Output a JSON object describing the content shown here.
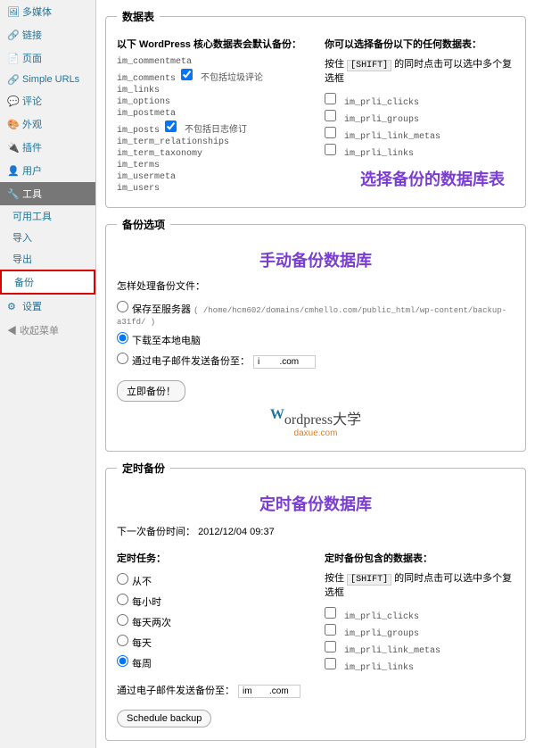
{
  "sidebar": {
    "items": [
      {
        "label": "多媒体"
      },
      {
        "label": "链接"
      },
      {
        "label": "页面"
      },
      {
        "label": "Simple URLs"
      },
      {
        "label": "评论"
      },
      {
        "label": "外观"
      },
      {
        "label": "插件"
      },
      {
        "label": "用户"
      },
      {
        "label": "工具"
      }
    ],
    "sub": [
      {
        "label": "可用工具"
      },
      {
        "label": "导入"
      },
      {
        "label": "导出"
      },
      {
        "label": "备份"
      }
    ],
    "settings": "设置",
    "collapse": "收起菜单"
  },
  "data_tables": {
    "legend": "数据表",
    "left_heading": "以下 WordPress 核心数据表会默认备份：",
    "right_heading": "你可以选择备份以下的任何数据表：",
    "hint_prefix": "按住",
    "hint_key": "[SHIFT]",
    "hint_suffix": "的同时点击可以选中多个复选框",
    "core": [
      "im_commentmeta",
      "im_comments",
      "im_links",
      "im_options",
      "im_postmeta",
      "im_posts",
      "im_term_relationships",
      "im_term_taxonomy",
      "im_terms",
      "im_usermeta",
      "im_users"
    ],
    "comments_note": "不包括垃圾评论",
    "posts_note": "不包括日志修订",
    "extra": [
      "im_prli_clicks",
      "im_prli_groups",
      "im_prli_link_metas",
      "im_prli_links"
    ],
    "annotation": "选择备份的数据库表"
  },
  "backup_opts": {
    "legend": "备份选项",
    "annotation": "手动备份数据库",
    "how": "怎样处理备份文件：",
    "opt1_label": "保存至服务器",
    "opt1_path": "( /home/hcm602/domains/cmhello.com/public_html/wp-content/backup-a31fd/ )",
    "opt2_label": "下载至本地电脑",
    "opt3_label": "通过电子邮件发送备份至：",
    "opt3_value": "i        .com",
    "button": "立即备份！",
    "logo_text": "ordpress大学",
    "logo_sub": "daxue.com"
  },
  "schedule": {
    "legend": "定时备份",
    "annotation": "定时备份数据库",
    "next_label": "下一次备份时间：",
    "next_value": "2012/12/04 09:37",
    "task_heading": "定时任务：",
    "tasks": [
      "从不",
      "每小时",
      "每天两次",
      "每天",
      "每周"
    ],
    "selected": 4,
    "email_label": "通过电子邮件发送备份至：",
    "email_value": "im       .com",
    "include_heading": "定时备份包含的数据表：",
    "include_hint_prefix": "按住",
    "include_hint_key": "[SHIFT]",
    "include_hint_suffix": "的同时点击可以选中多个复选框",
    "include": [
      "im_prli_clicks",
      "im_prli_groups",
      "im_prli_link_metas",
      "im_prli_links"
    ],
    "button": "Schedule backup"
  }
}
